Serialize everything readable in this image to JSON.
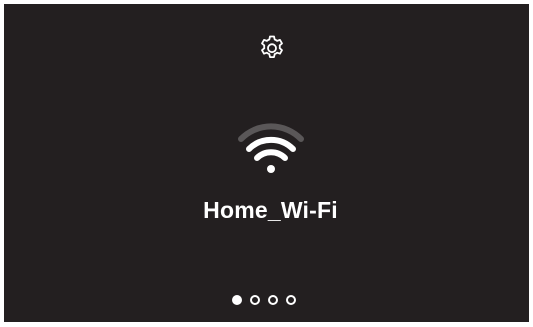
{
  "header": {
    "settings_icon": "gear-icon"
  },
  "network": {
    "icon": "wifi-icon",
    "signal_bars_filled": 3,
    "signal_bars_total": 4,
    "name": "Home_Wi-Fi"
  },
  "pager": {
    "total_pages": 4,
    "current_page": 1
  },
  "colors": {
    "background": "#231f20",
    "foreground": "#ffffff",
    "inactive_signal": "#5a5758"
  }
}
